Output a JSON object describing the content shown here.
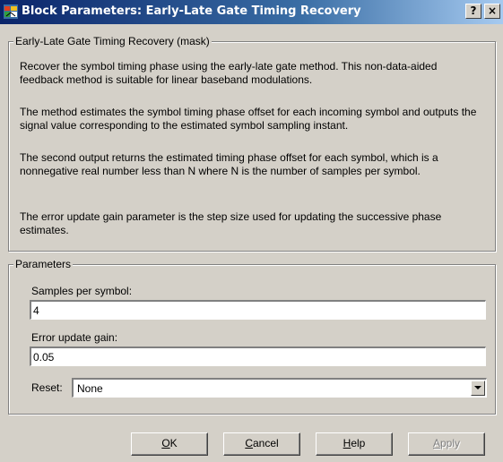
{
  "window": {
    "title": "Block Parameters: Early-Late Gate Timing Recovery",
    "help_button": "?",
    "close_button": "×",
    "icon": "simulink-block-icon"
  },
  "mask": {
    "legend": "Early-Late Gate Timing Recovery (mask)",
    "paragraphs": [
      "Recover the symbol timing phase using the early-late gate method. This non-data-aided feedback method is suitable for linear baseband modulations.",
      "The method estimates the symbol timing phase offset for each incoming symbol and outputs the signal value corresponding to the estimated symbol sampling instant.",
      "The second output returns the estimated timing phase offset for each symbol, which is a nonnegative real number less than N where N is the number of samples per symbol.",
      "The error update gain parameter is the step size used for updating the successive phase estimates."
    ]
  },
  "parameters": {
    "legend": "Parameters",
    "samples_label": "Samples per symbol:",
    "samples_value": "4",
    "gain_label": "Error update gain:",
    "gain_value": "0.05",
    "reset_label": "Reset:",
    "reset_value": "None"
  },
  "buttons": {
    "ok": {
      "mnemonic": "O",
      "rest": "K"
    },
    "cancel": {
      "mnemonic": "C",
      "rest": "ancel"
    },
    "help": {
      "mnemonic": "H",
      "rest": "elp"
    },
    "apply": {
      "mnemonic": "A",
      "rest": "pply"
    }
  }
}
